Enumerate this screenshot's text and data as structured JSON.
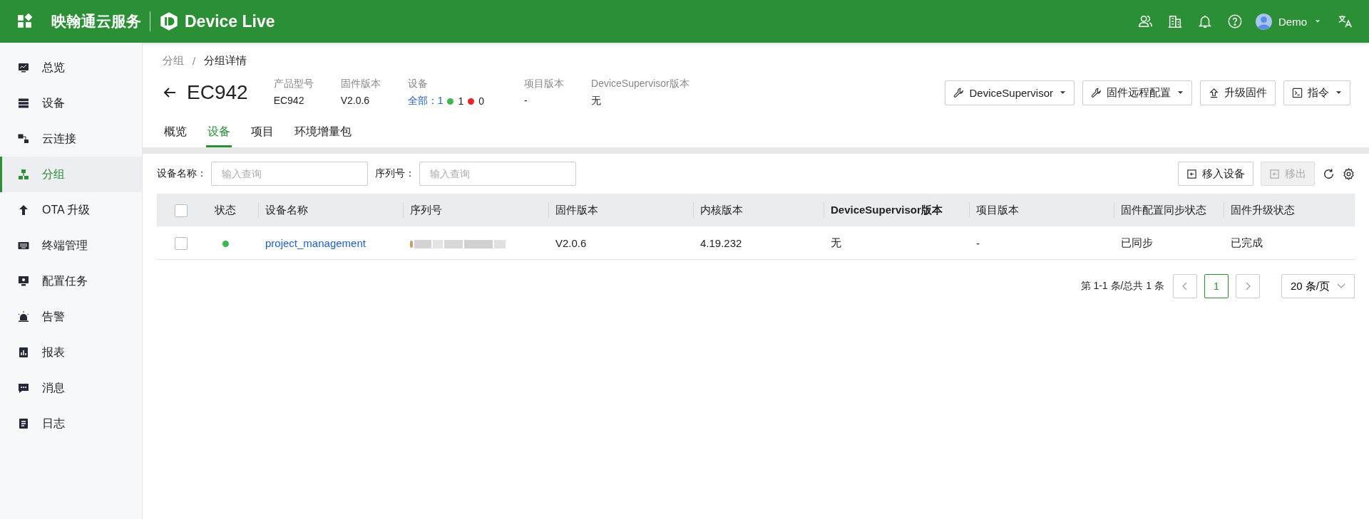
{
  "header": {
    "brand": "映翰通云服务",
    "product": "Device Live",
    "user": "Demo"
  },
  "sidebar": {
    "items": [
      {
        "label": "总览",
        "selected": false
      },
      {
        "label": "设备",
        "selected": false
      },
      {
        "label": "云连接",
        "selected": false
      },
      {
        "label": "分组",
        "selected": true
      },
      {
        "label": "OTA 升级",
        "selected": false
      },
      {
        "label": "终端管理",
        "selected": false
      },
      {
        "label": "配置任务",
        "selected": false
      },
      {
        "label": "告警",
        "selected": false
      },
      {
        "label": "报表",
        "selected": false
      },
      {
        "label": "消息",
        "selected": false
      },
      {
        "label": "日志",
        "selected": false
      }
    ]
  },
  "breadcrumb": {
    "separator": "/",
    "items": [
      "分组",
      "分组详情"
    ]
  },
  "title": "EC942",
  "info_fields": [
    {
      "kind": "text",
      "label": "产品型号",
      "value": "EC942"
    },
    {
      "kind": "text",
      "label": "固件版本",
      "value": "V2.0.6"
    },
    {
      "kind": "counts",
      "label": "设备",
      "total_label": "全部：",
      "total": "1",
      "online": "1",
      "offline": "0"
    },
    {
      "kind": "text",
      "label": "项目版本",
      "value": "-"
    },
    {
      "kind": "text",
      "label": "DeviceSupervisor版本",
      "value": "无"
    }
  ],
  "actions": [
    {
      "label": "DeviceSupervisor",
      "dropdown": true
    },
    {
      "label": "固件远程配置",
      "dropdown": true
    },
    {
      "label": "升级固件",
      "dropdown": false
    },
    {
      "label": "指令",
      "dropdown": true
    }
  ],
  "tabs": [
    {
      "label": "概览",
      "selected": false
    },
    {
      "label": "设备",
      "selected": true
    },
    {
      "label": "项目",
      "selected": false
    },
    {
      "label": "环境增量包",
      "selected": false
    }
  ],
  "filters": [
    {
      "label": "设备名称：",
      "placeholder": "输入查询"
    },
    {
      "label": "序列号：",
      "placeholder": "输入查询"
    }
  ],
  "toolbar_buttons": [
    {
      "label": "移入设备",
      "disabled": false
    },
    {
      "label": "移出",
      "disabled": true
    }
  ],
  "table": {
    "select_all_checked": false,
    "columns": [
      "状态",
      "设备名称",
      "序列号",
      "固件版本",
      "内核版本",
      "DeviceSupervisor版本",
      "项目版本",
      "固件配置同步状态",
      "固件升级状态"
    ],
    "rows": [
      {
        "checked": false,
        "online": true,
        "name": "project_management",
        "firmware": "V2.0.6",
        "kernel": "4.19.232",
        "ds_version": "无",
        "project_version": "-",
        "sync_status": "已同步",
        "upgrade_status": "已完成"
      }
    ]
  },
  "pagination": {
    "summary": "第 1-1 条/总共 1 条",
    "pages": [
      {
        "label": "1",
        "selected": true
      }
    ],
    "page_size": "20 条/页"
  }
}
